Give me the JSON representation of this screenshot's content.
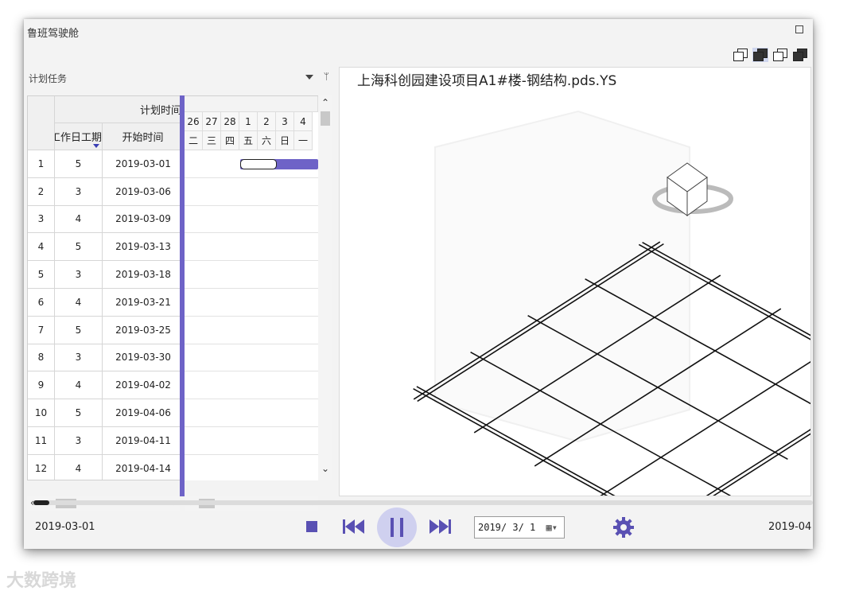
{
  "window": {
    "title": "鲁班驾驶舱"
  },
  "left_panel": {
    "title": "计划任务",
    "grid": {
      "group_header": "计划时间",
      "col_headers": [
        "工作日工期",
        "开始时间"
      ],
      "rows": [
        {
          "no": "1",
          "days": "5",
          "start": "2019-03-01"
        },
        {
          "no": "2",
          "days": "3",
          "start": "2019-03-06"
        },
        {
          "no": "3",
          "days": "4",
          "start": "2019-03-09"
        },
        {
          "no": "4",
          "days": "5",
          "start": "2019-03-13"
        },
        {
          "no": "5",
          "days": "3",
          "start": "2019-03-18"
        },
        {
          "no": "6",
          "days": "4",
          "start": "2019-03-21"
        },
        {
          "no": "7",
          "days": "5",
          "start": "2019-03-25"
        },
        {
          "no": "8",
          "days": "3",
          "start": "2019-03-30"
        },
        {
          "no": "9",
          "days": "4",
          "start": "2019-04-02"
        },
        {
          "no": "10",
          "days": "5",
          "start": "2019-04-06"
        },
        {
          "no": "11",
          "days": "3",
          "start": "2019-04-11"
        },
        {
          "no": "12",
          "days": "4",
          "start": "2019-04-14"
        }
      ]
    },
    "gantt": {
      "days": [
        "26",
        "27",
        "28",
        "1",
        "2",
        "3",
        "4"
      ],
      "weekdays": [
        "二",
        "三",
        "四",
        "五",
        "六",
        "日",
        "一"
      ],
      "bar_color": "#6e63c7"
    }
  },
  "viewport": {
    "title": "上海科创园建设项目A1#楼-钢结构.pds.YS"
  },
  "playback": {
    "start_date": "2019-03-01",
    "end_date": "2019-04",
    "current_date": "2019/ 3/ 1",
    "progress": 0.02,
    "accent": "#5950b3"
  },
  "watermark": "大数跨境"
}
